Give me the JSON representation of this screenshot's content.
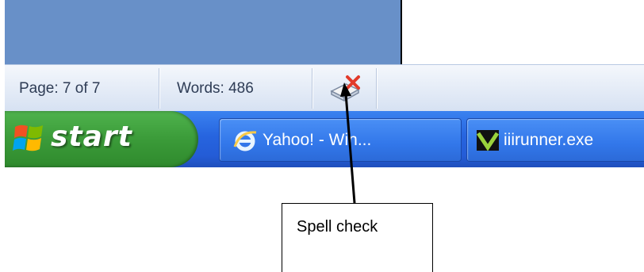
{
  "status_bar": {
    "page_label": "Page: 7 of 7",
    "words_label": "Words: 486",
    "spell_icon": "spell-check-book-icon"
  },
  "taskbar": {
    "start_label": "start",
    "start_logo": "windows-flag-logo",
    "items": [
      {
        "label": "Yahoo! - Win...",
        "icon": "internet-explorer-icon"
      },
      {
        "label": "iiirunner.exe",
        "icon": "iiirunner-icon"
      }
    ]
  },
  "annotation": {
    "callout_text": "Spell check"
  },
  "colors": {
    "taskbar_blue": "#245cd6",
    "start_green": "#3b9b39",
    "statusbar_bg": "#e2eaf6",
    "panel_blue": "#6890c8"
  }
}
